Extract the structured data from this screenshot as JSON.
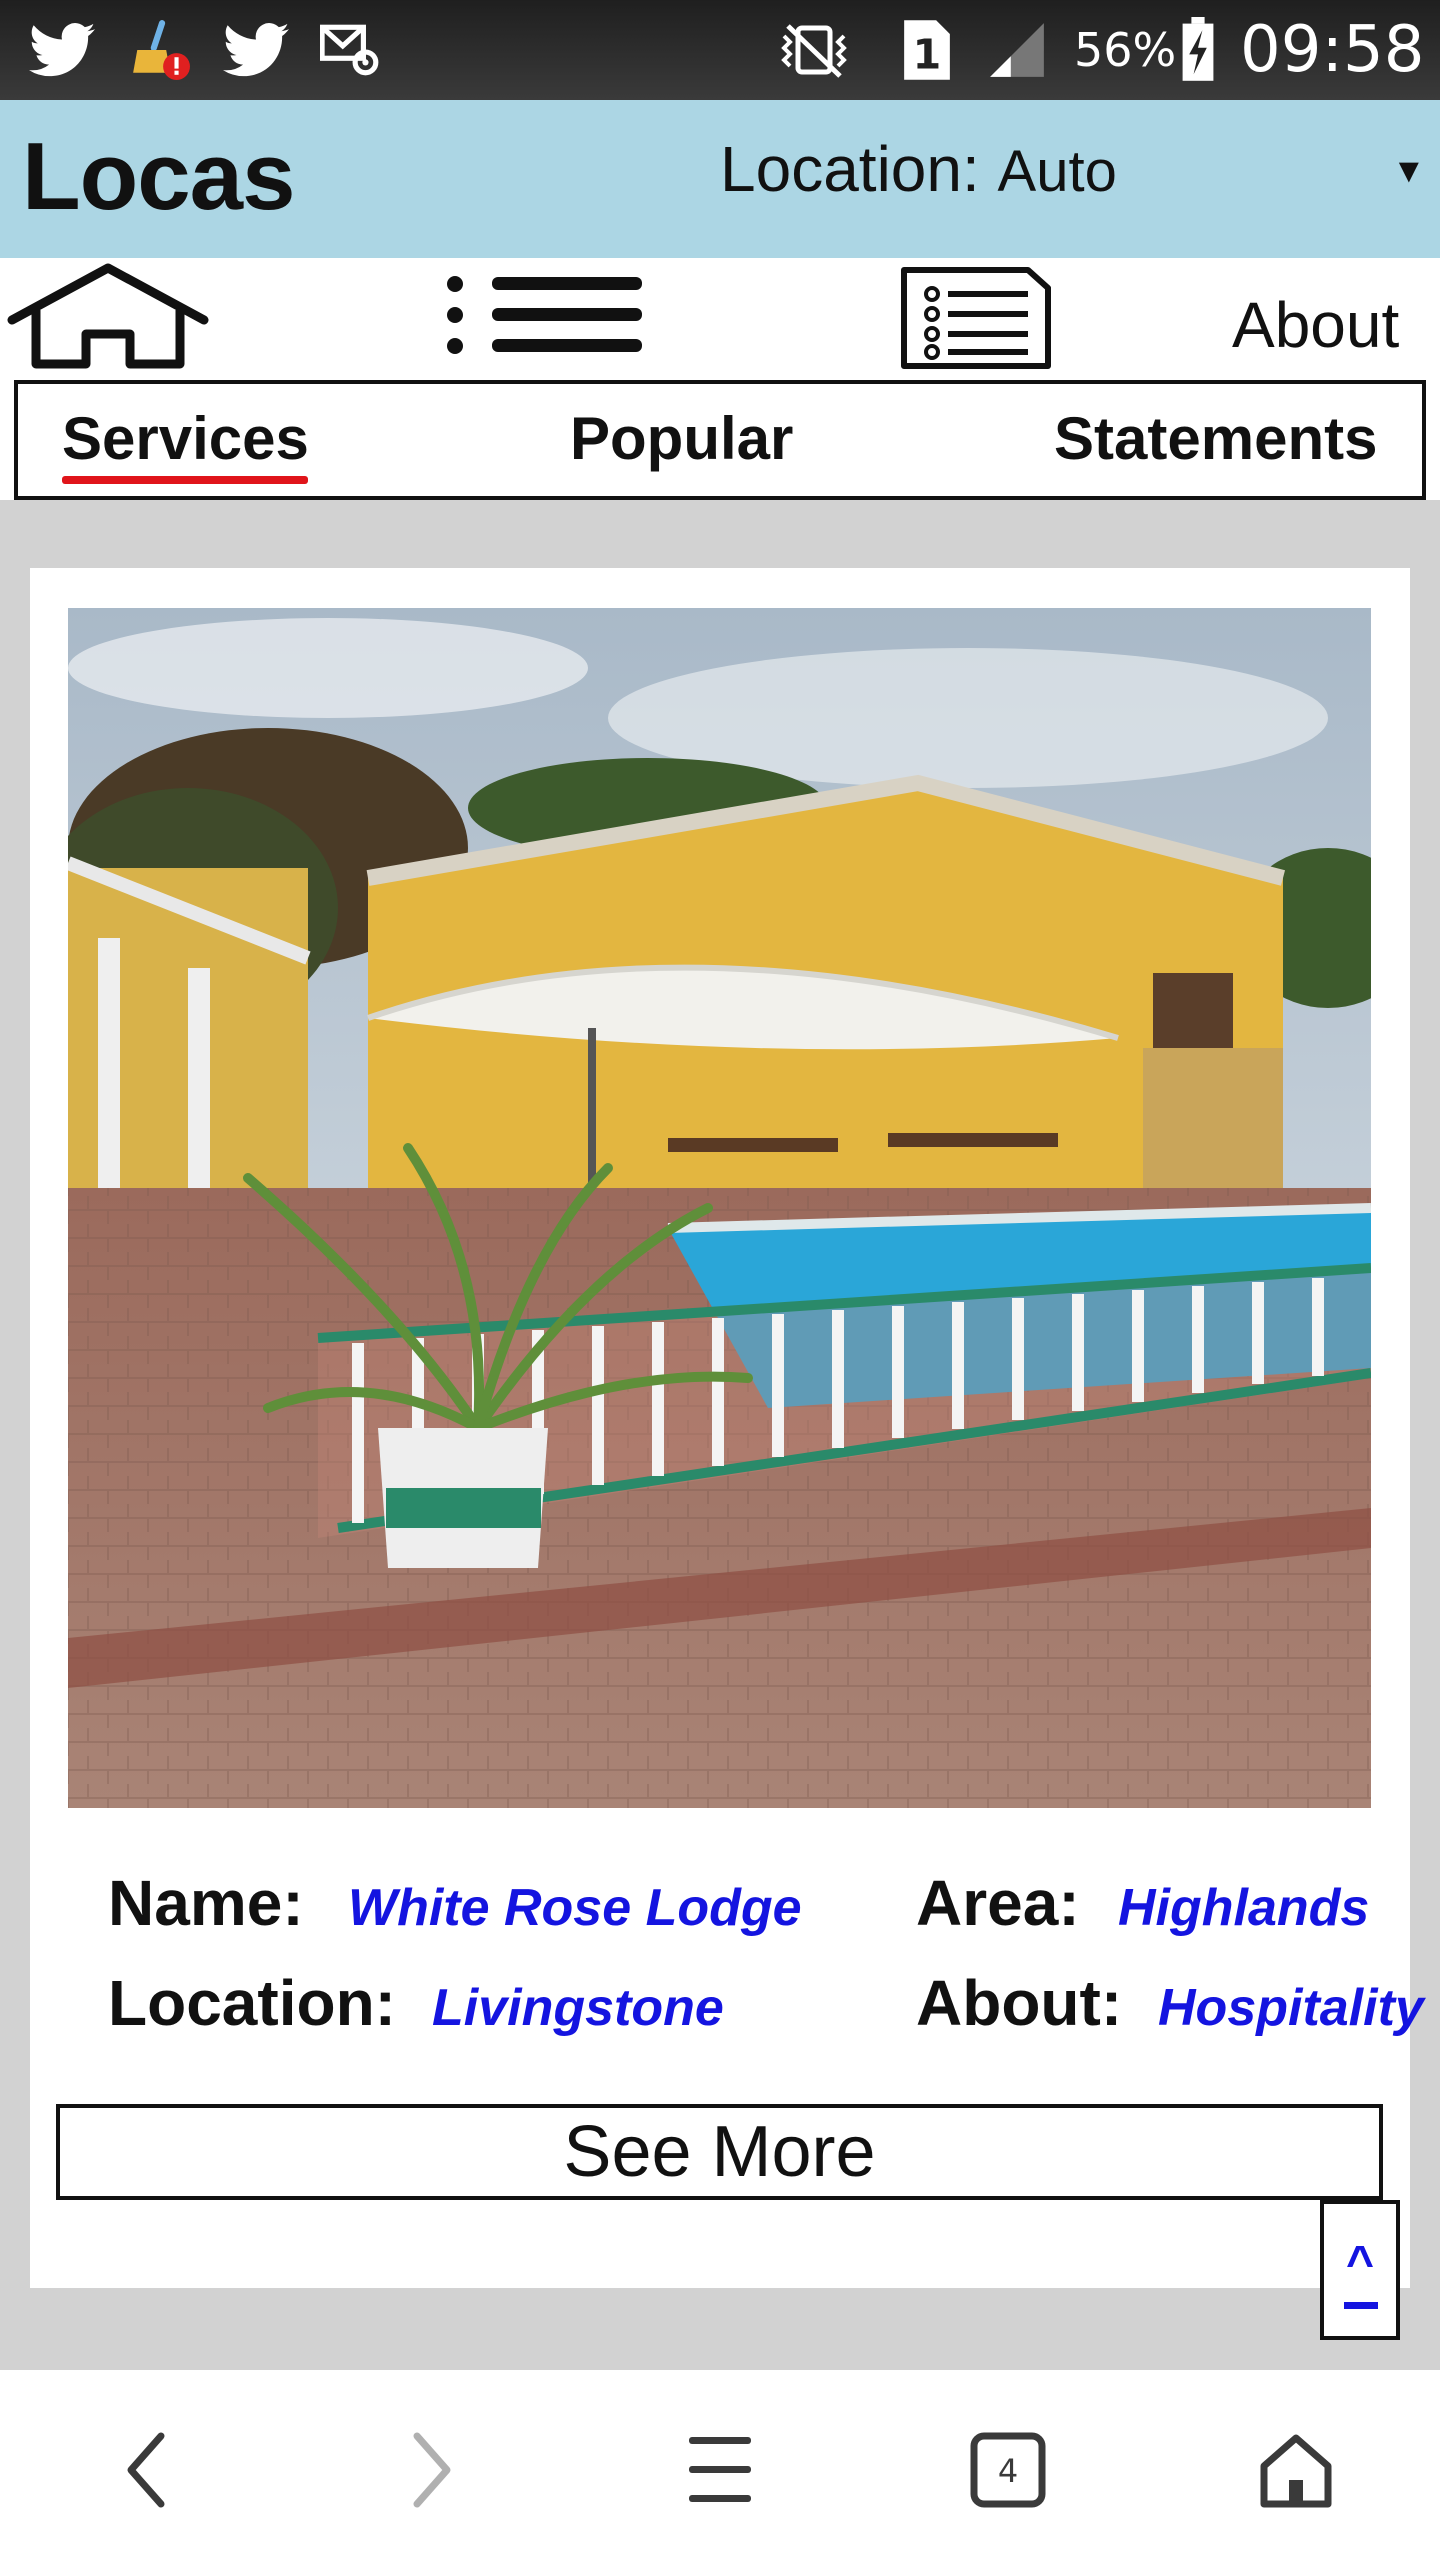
{
  "status_bar": {
    "battery_percent": "56%",
    "time": "09:58",
    "sim_slot": "1",
    "icons": [
      "twitter-icon",
      "cleaner-alert-icon",
      "twitter-icon",
      "mail-settings-icon",
      "vibrate-silent-icon",
      "sim-icon",
      "signal-icon",
      "battery-charging-icon"
    ]
  },
  "header": {
    "app_title": "Locas",
    "location_label": "Location:",
    "location_value": "Auto",
    "dropdown_caret": "▼"
  },
  "nav": {
    "icons": [
      "home-icon",
      "list-icon",
      "document-icon"
    ],
    "about_label": "About"
  },
  "tabs": [
    {
      "label": "Services",
      "active": true
    },
    {
      "label": "Popular",
      "active": false
    },
    {
      "label": "Statements",
      "active": false
    }
  ],
  "listing": {
    "name_label": "Name:",
    "name_value": "White Rose Lodge",
    "area_label": "Area:",
    "area_value": "Highlands",
    "location_label": "Location:",
    "location_value": "Livingstone",
    "about_label": "About:",
    "about_value": "Hospitality",
    "see_more_label": "See More"
  },
  "scroll_top": {
    "caret": "^"
  },
  "browser_bar": {
    "tab_count": "4",
    "icons": [
      "back-icon",
      "forward-icon",
      "menu-icon",
      "tabs-icon",
      "home-icon"
    ]
  },
  "colors": {
    "header_bg": "#acd6e4",
    "active_tab_underline": "#e0141a",
    "value_text": "#1414e0",
    "content_bg": "#d2d2d2"
  }
}
